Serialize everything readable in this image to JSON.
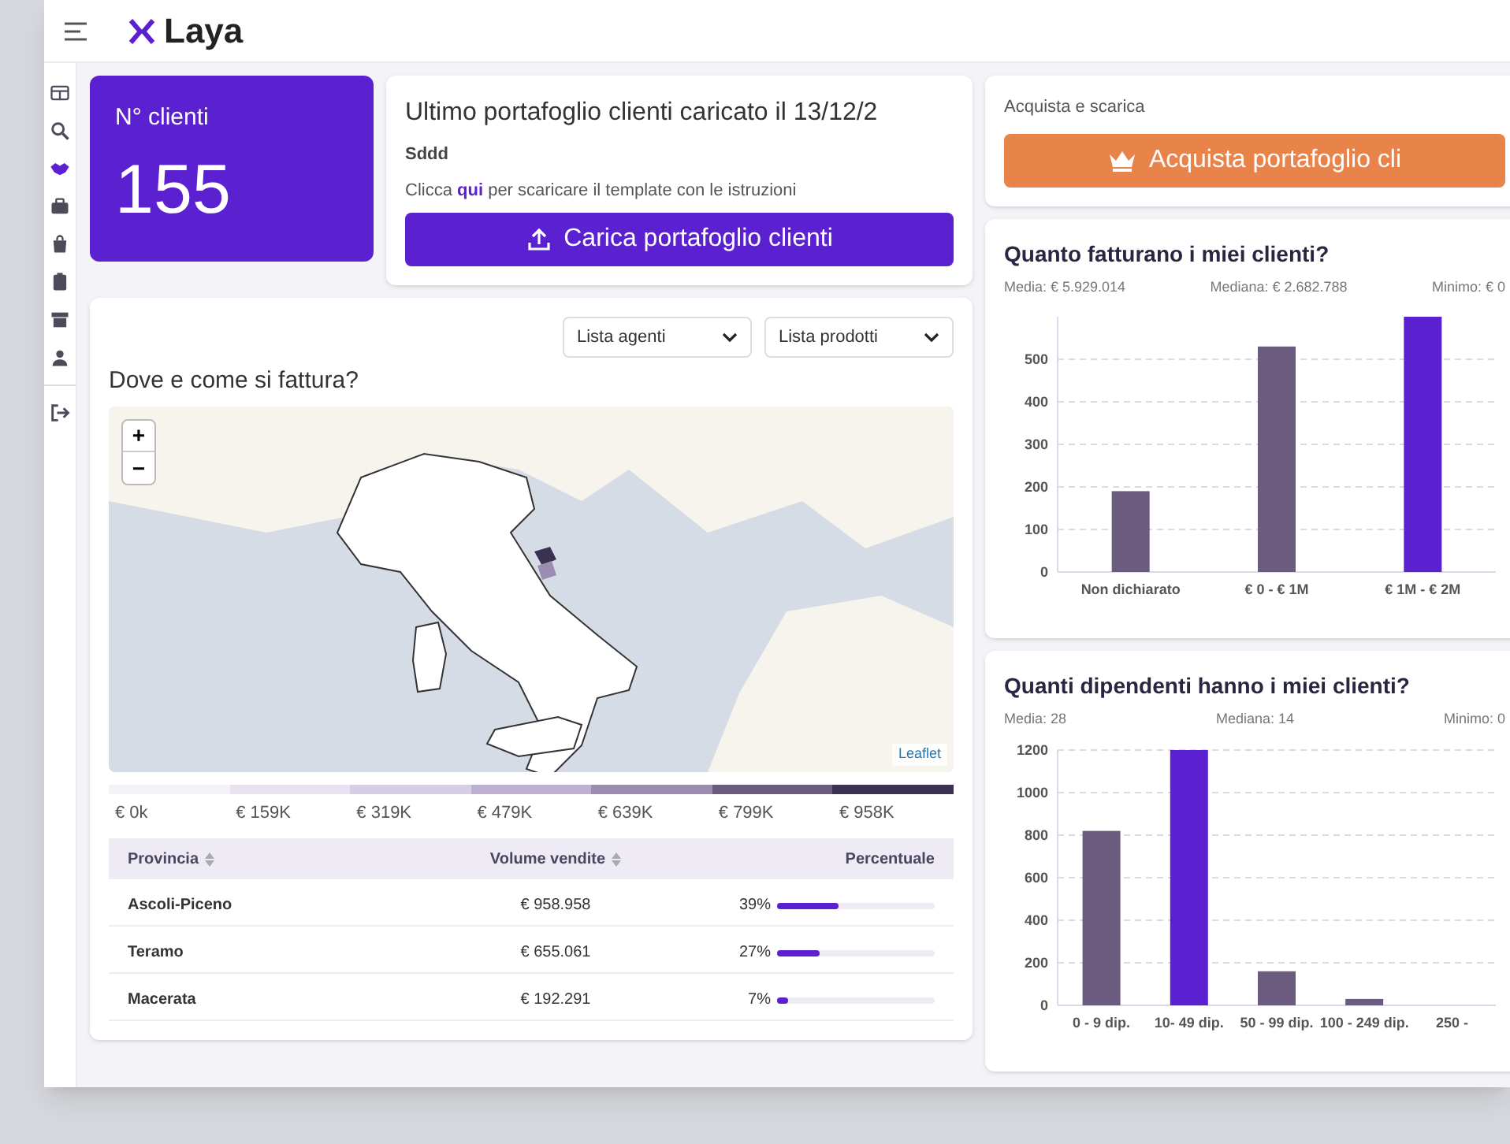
{
  "header": {
    "logo": "Laya"
  },
  "sidebar": {
    "items": [
      {
        "selected": false
      },
      {
        "selected": false
      },
      {
        "selected": true
      },
      {
        "selected": false
      },
      {
        "selected": false
      },
      {
        "selected": false
      },
      {
        "selected": false
      },
      {
        "selected": false
      }
    ],
    "logout": {
      "selected": false
    }
  },
  "clients_card": {
    "label": "N° clienti",
    "value": "155"
  },
  "upload_card": {
    "title": "Ultimo portafoglio clienti caricato il 13/12/2",
    "file": "Sddd",
    "hint": "Clicca **qui** per scaricare il template con le istruzioni",
    "button": "Carica portafoglio clienti"
  },
  "buy_card": {
    "text": "Acquista e scarica",
    "button": "Acquista portafoglio cli"
  },
  "map_card": {
    "filters": [
      "Lista agenti",
      "Lista prodotti"
    ],
    "title": "Dove e come si fattura?",
    "zoom_in": "+",
    "zoom_out": "−",
    "attribution": "Leaflet",
    "legend": [
      {
        "label": "€ 0k",
        "color": "#f4f1f8"
      },
      {
        "label": "€ 159K",
        "color": "#e7e1f0"
      },
      {
        "label": "€ 319K",
        "color": "#d7cde5"
      },
      {
        "label": "€ 479K",
        "color": "#bdb0d1"
      },
      {
        "label": "€ 639K",
        "color": "#9c8cb2"
      },
      {
        "label": "€ 799K",
        "color": "#6b5b7e"
      },
      {
        "label": "€ 958K",
        "color": "#3b3150"
      }
    ],
    "table": {
      "columns": [
        "Provincia",
        "Volume vendite",
        "Percentuale"
      ],
      "rows": [
        {
          "provincia": "Ascoli-Piceno",
          "volume": "€ 958.958",
          "percent": "39%",
          "level": 0.39
        },
        {
          "provincia": "Teramo",
          "volume": "€ 655.061",
          "percent": "27%",
          "level": 0.27
        },
        {
          "provincia": "Macerata",
          "volume": "€ 192.291",
          "percent": "7%",
          "level": 0.07
        }
      ]
    }
  },
  "revenue_card": {
    "title": "Quanto fatturano i miei clienti?",
    "stats": [
      "Media: € 5.929.014",
      "Mediana: € 2.682.788",
      "Minimo: € 0"
    ],
    "chart_data": {
      "type": "bar",
      "grid": true,
      "categories": [
        "Non dichiarato",
        "€ 0 - € 1M",
        "€ 1M - € 2M"
      ],
      "ylim": [
        0,
        600
      ],
      "yticks": [
        0,
        100,
        200,
        300,
        400,
        500
      ],
      "series": [
        {
          "color": "#6b5b7e",
          "values": [
            190,
            530,
            null
          ]
        },
        {
          "color": "#5b21d1",
          "values": [
            null,
            null,
            600
          ]
        }
      ]
    }
  },
  "employees_card": {
    "title": "Quanti dipendenti hanno i miei clienti?",
    "stats": [
      "Media: 28",
      "Mediana: 14",
      "Minimo: 0"
    ],
    "chart_data": {
      "type": "bar",
      "categories": [
        "0 - 9 dip.",
        "10- 49 dip.",
        "50 - 99 dip.",
        "100 - 249 dip.",
        "250 -"
      ],
      "grid": true,
      "ylim": [
        0,
        1200
      ],
      "yticks": [
        0,
        200,
        400,
        600,
        800,
        1000,
        1200
      ],
      "series": [
        {
          "color": "#6b5b7e",
          "values": [
            820,
            null,
            160,
            30,
            null
          ]
        },
        {
          "color": "#5b21d1",
          "values": [
            null,
            1200,
            null,
            null,
            null
          ]
        }
      ]
    }
  }
}
